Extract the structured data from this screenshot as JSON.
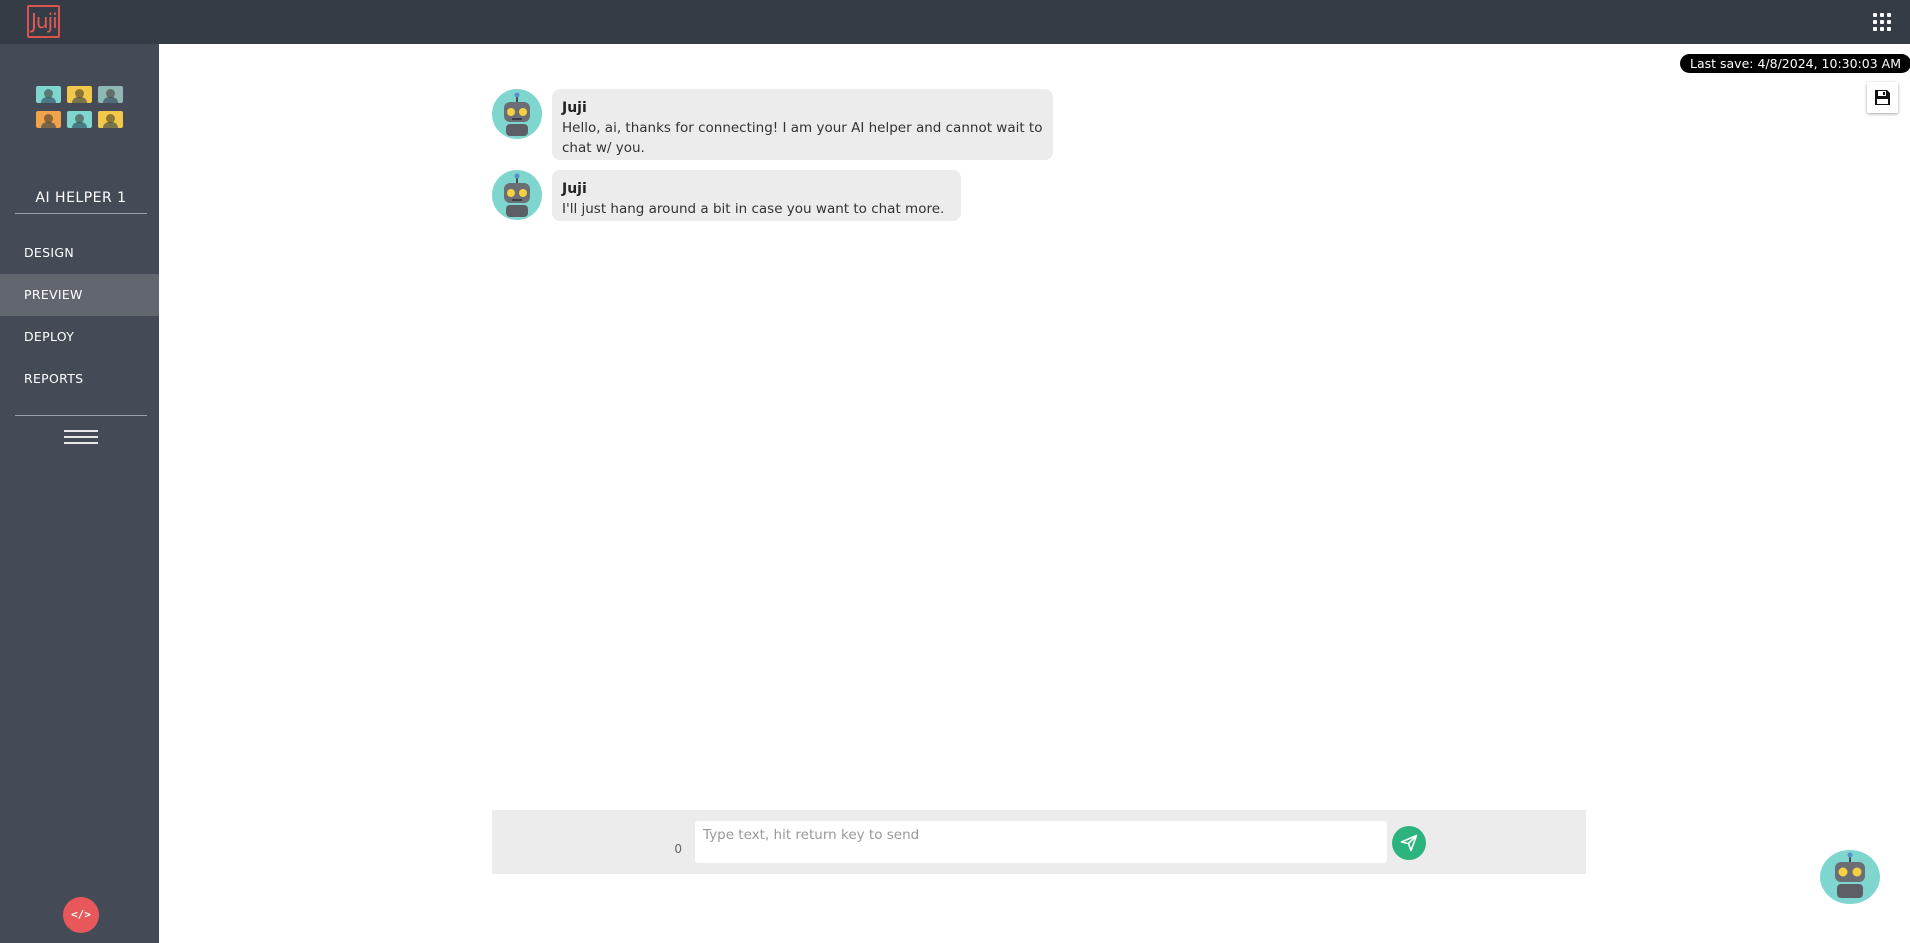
{
  "header": {
    "logo_text": "Juji"
  },
  "sidebar": {
    "helper_name": "AI HELPER 1",
    "nav_items": [
      {
        "label": "DESIGN",
        "active": false
      },
      {
        "label": "PREVIEW",
        "active": true
      },
      {
        "label": "DEPLOY",
        "active": false
      },
      {
        "label": "REPORTS",
        "active": false
      }
    ],
    "code_button_label": "</>",
    "avatar_colors": [
      "#7ed6cf",
      "#f2c84b",
      "#8fb8b4",
      "#f0a34a",
      "#7ed6cf",
      "#f2c84b"
    ]
  },
  "main": {
    "last_save": "Last save: 4/8/2024, 10:30:03 AM",
    "messages": [
      {
        "sender": "Juji",
        "text": "Hello, ai, thanks for connecting! I am your AI helper and cannot wait to chat w/ you."
      },
      {
        "sender": "Juji",
        "text": "I'll just hang around a bit in case you want to chat more."
      }
    ],
    "input": {
      "placeholder": "Type text, hit return key to send",
      "value": "",
      "char_count": "0"
    }
  },
  "colors": {
    "topbar": "#363c45",
    "sidebar": "#444b56",
    "active_nav": "#62676f",
    "send_button": "#2db37e",
    "code_button": "#e8585a",
    "bubble": "#ececec",
    "bot_teal": "#7ed6cf"
  },
  "icons": {
    "apps": "grid-icon",
    "save": "floppy-disk-icon",
    "send": "paper-plane-icon",
    "menu": "hamburger-icon",
    "code": "code-icon"
  }
}
